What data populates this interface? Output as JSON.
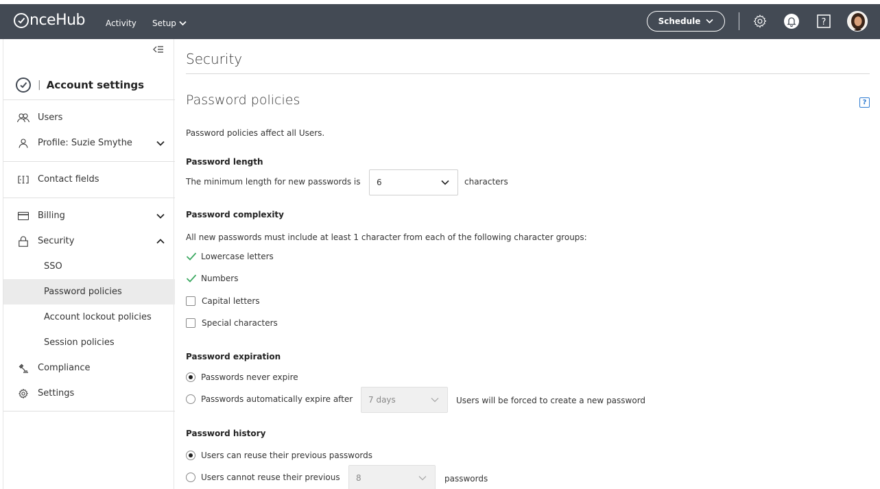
{
  "topbar": {
    "logo_text": "nceHub",
    "nav": [
      {
        "label": "Activity"
      },
      {
        "label": "Setup"
      }
    ],
    "schedule_label": "Schedule",
    "help_glyph": "?"
  },
  "sidebar": {
    "title": "Account settings",
    "items": [
      {
        "label": "Users",
        "icon": "users-icon"
      },
      {
        "label": "Profile: Suzie Smythe",
        "icon": "person-icon"
      },
      {
        "label": "Contact fields",
        "icon": "contact-fields-icon"
      },
      {
        "label": "Billing",
        "icon": "credit-card-icon"
      },
      {
        "label": "Security",
        "icon": "lock-icon"
      },
      {
        "label": "Compliance",
        "icon": "gavel-icon"
      },
      {
        "label": "Settings",
        "icon": "gear-icon"
      }
    ],
    "security_sub": [
      {
        "label": "SSO"
      },
      {
        "label": "Password policies",
        "active": true
      },
      {
        "label": "Account lockout policies"
      },
      {
        "label": "Session policies"
      }
    ]
  },
  "main": {
    "page_title": "Security",
    "section_title": "Password policies",
    "help_glyph": "?",
    "intro": "Password policies affect all Users.",
    "length": {
      "heading": "Password length",
      "prefix": "The minimum length for new passwords is",
      "value": "6",
      "suffix": "characters"
    },
    "complexity": {
      "heading": "Password complexity",
      "description": "All new passwords must include at least 1 character from each of the following character groups:",
      "options": [
        {
          "label": "Lowercase letters",
          "checked": true
        },
        {
          "label": "Numbers",
          "checked": true
        },
        {
          "label": "Capital letters",
          "checked": false
        },
        {
          "label": "Special characters",
          "checked": false
        }
      ]
    },
    "expiration": {
      "heading": "Password expiration",
      "never_label": "Passwords never expire",
      "auto_label": "Passwords automatically expire after",
      "auto_value": "7 days",
      "auto_suffix": "Users will be forced to create a new password",
      "selected": "never"
    },
    "history": {
      "heading": "Password history",
      "reuse_label": "Users can reuse their previous passwords",
      "noreuse_label": "Users cannot reuse their previous",
      "noreuse_value": "8",
      "noreuse_suffix": "passwords",
      "selected": "reuse"
    }
  },
  "colors": {
    "topbar": "#434a54",
    "check_green": "#3aa860",
    "help_blue": "#2d7bd1",
    "active_bg": "#ebebeb"
  }
}
